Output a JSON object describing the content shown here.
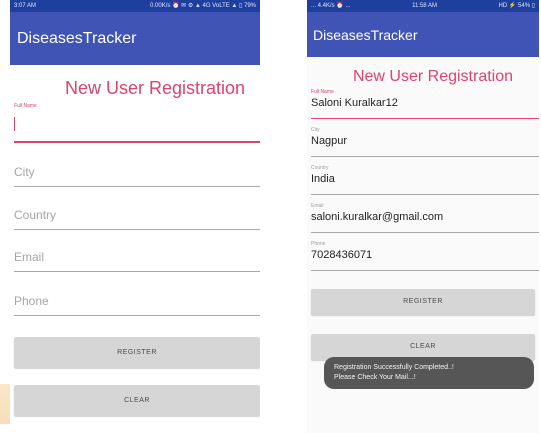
{
  "left_screen": {
    "status_bar": {
      "left": "3:07 AM",
      "right": "0.00K/s ⏰ ✉ ⚙ ▲ 4G VoLTE ▲ ▯ 79%"
    },
    "app_title": "DiseasesTracker",
    "heading": "New User Registration",
    "fields": [
      {
        "label": "Full Name",
        "placeholder": "",
        "value": ""
      },
      {
        "label": "",
        "placeholder": "City",
        "value": ""
      },
      {
        "label": "",
        "placeholder": "Country",
        "value": ""
      },
      {
        "label": "",
        "placeholder": "Email",
        "value": ""
      },
      {
        "label": "",
        "placeholder": "Phone",
        "value": ""
      }
    ],
    "register_button": "REGISTER",
    "clear_button": "CLEAR"
  },
  "right_screen": {
    "status_bar": {
      "left": "... 4.4K/s ⏰ ...",
      "center": "11:58 AM",
      "right": "HD ⚡ 54% ▯"
    },
    "app_title": "DiseasesTracker",
    "heading": "New User Registration",
    "fields": [
      {
        "label": "Full Name",
        "value": "Saloni Kuralkar12"
      },
      {
        "label": "City",
        "value": "Nagpur"
      },
      {
        "label": "Country",
        "value": "India"
      },
      {
        "label": "Email",
        "value": "saloni.kuralkar@gmail.com"
      },
      {
        "label": "Phone",
        "value": "7028436071"
      }
    ],
    "register_button": "REGISTER",
    "clear_button": "CLEAR",
    "toast": {
      "line1": "Registration Successfully Completed..!",
      "line2": "Please Check Your Mail...!"
    }
  },
  "colors": {
    "app_bar": "#3f54b5",
    "status_bar": "#1f3f9e",
    "accent": "#e0426c",
    "button": "#d6d6d6",
    "toast": "#565656"
  }
}
